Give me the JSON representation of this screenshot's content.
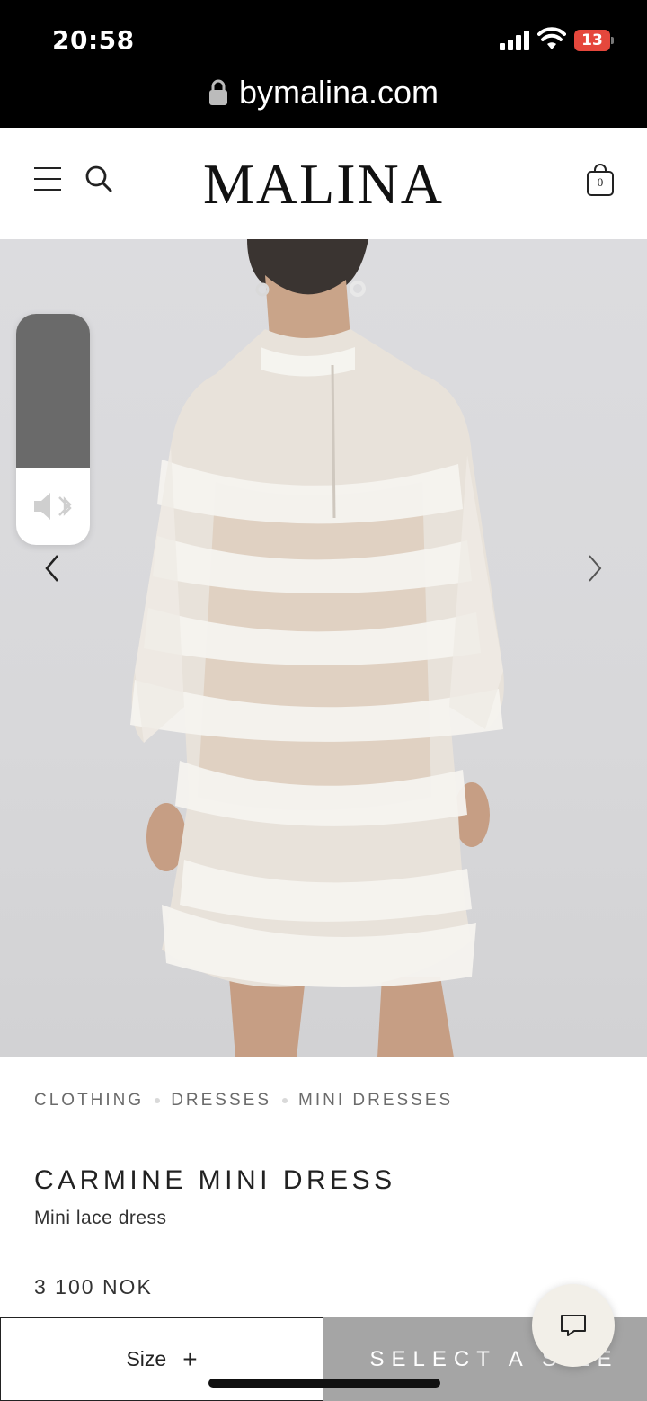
{
  "status_bar": {
    "time": "20:58",
    "battery_level": "13",
    "battery_color": "#e5473c"
  },
  "browser": {
    "url": "bymalina.com"
  },
  "header": {
    "brand": "MALINA",
    "cart_count": "0",
    "icons": [
      "menu-icon",
      "search-icon",
      "shopping-bag-icon"
    ]
  },
  "gallery": {
    "prev_icon": "chevron-left-icon",
    "next_icon": "chevron-right-icon",
    "image_description_icon": "product-photo"
  },
  "volume_hud": {
    "level": 0.67,
    "icon": "speaker-bluetooth-muted-icon"
  },
  "breadcrumb": [
    "CLOTHING",
    "DRESSES",
    "MINI DRESSES"
  ],
  "product": {
    "title": "CARMINE MINI DRESS",
    "subtitle": "Mini lace dress",
    "price": "3 100 NOK"
  },
  "actions": {
    "size_label": "Size",
    "size_plus": "+",
    "select_label": "SELECT A SIZE"
  },
  "colors": {
    "select_button_bg": "#a5a5a5",
    "chat_bg": "#f2efe8"
  }
}
